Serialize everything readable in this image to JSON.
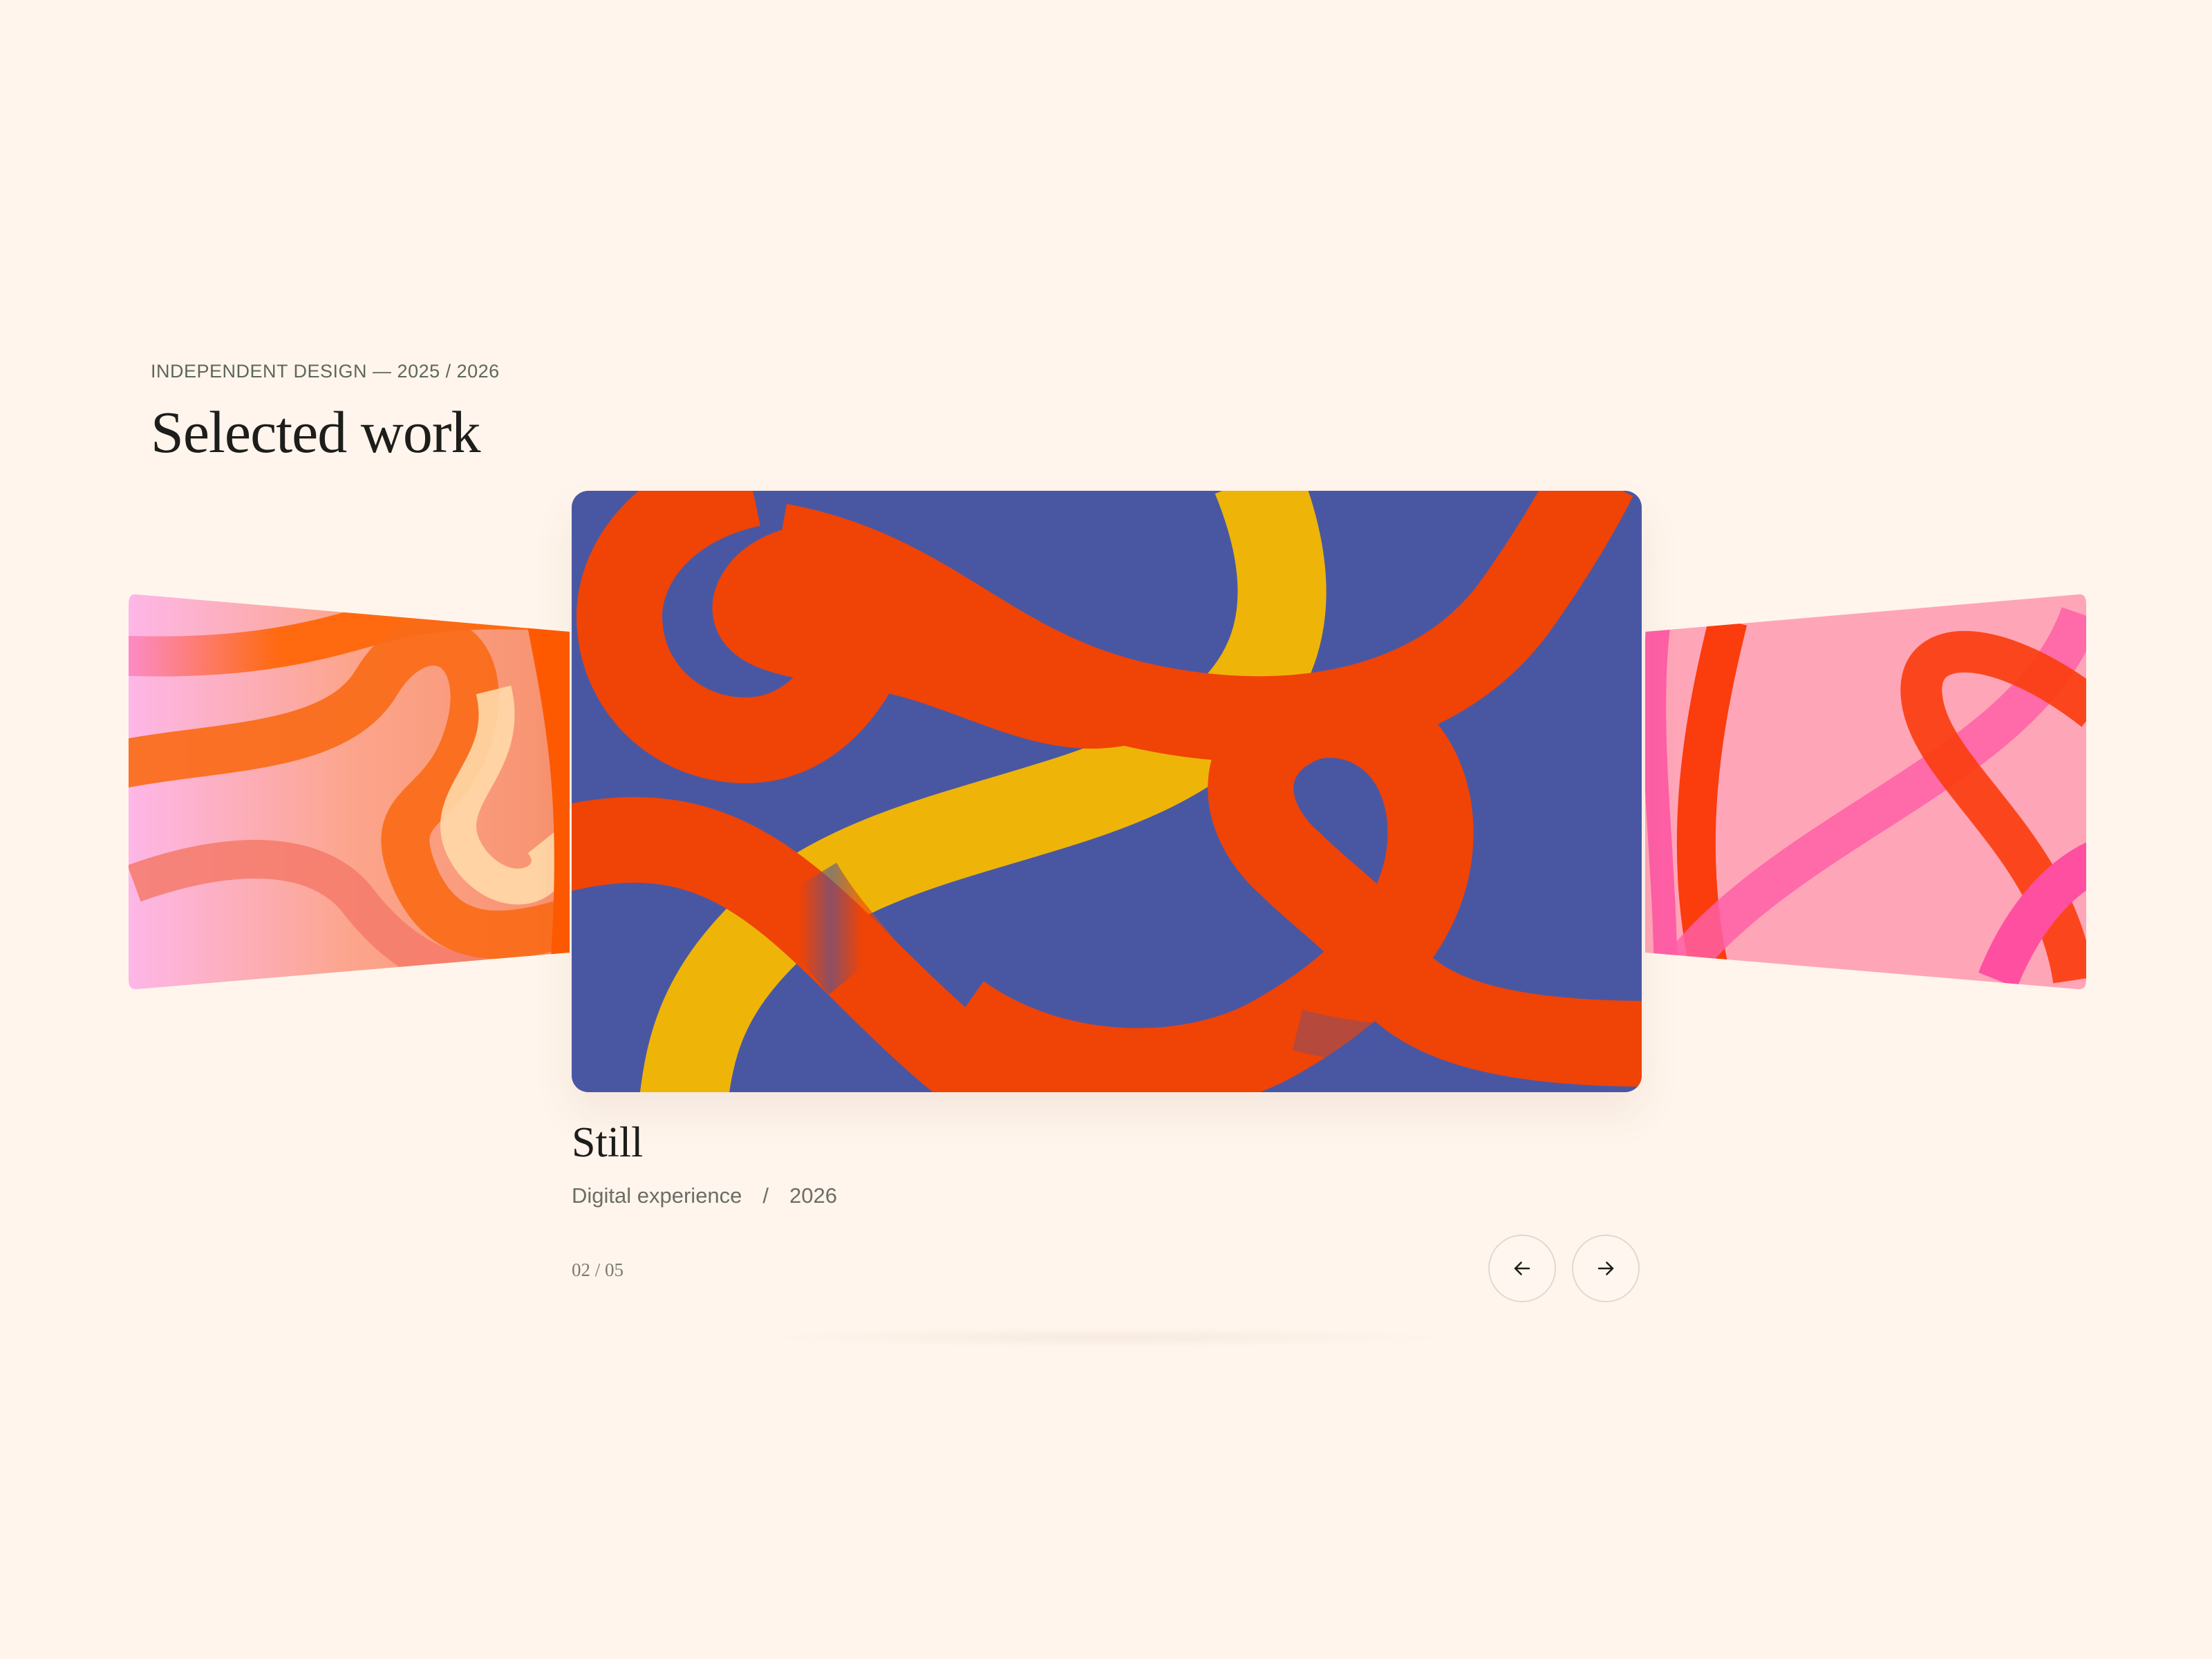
{
  "header": {
    "eyebrow": "INDEPENDENT DESIGN — 2025 / 2026",
    "title": "Selected work"
  },
  "carousel": {
    "current": {
      "title": "Still",
      "category": "Digital experience",
      "separator": "/",
      "year": "2026"
    },
    "counter": "02 / 05",
    "prev_icon": "arrow-left-icon",
    "next_icon": "arrow-right-icon"
  },
  "colors": {
    "background": "#fff5ec",
    "main_card_bg": "#4957a3",
    "ribbon_orange": "#f04306",
    "ribbon_yellow": "#eeb508",
    "left_card_bg": "#f9a07e",
    "right_card_bg": "#ffa5b8"
  }
}
